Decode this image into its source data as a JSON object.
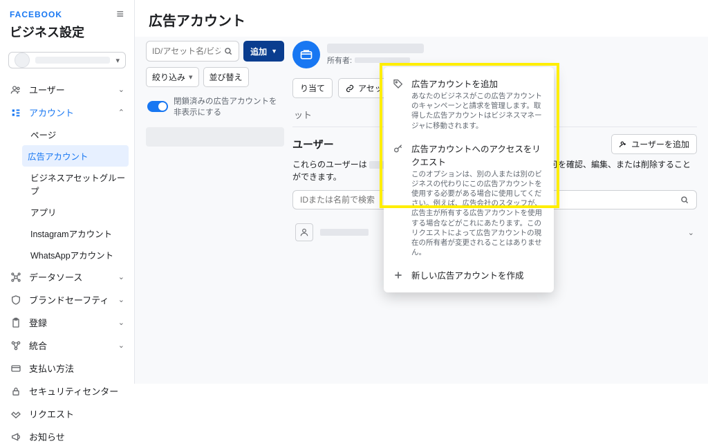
{
  "brand": "FACEBOOK",
  "sidebar_title": "ビジネス設定",
  "nav": {
    "users": "ユーザー",
    "accounts": "アカウント",
    "accounts_sub": {
      "page": "ページ",
      "ad_accounts": "広告アカウント",
      "asset_groups": "ビジネスアセットグループ",
      "apps": "アプリ",
      "instagram": "Instagramアカウント",
      "whatsapp": "WhatsAppアカウント"
    },
    "data_sources": "データソース",
    "brand_safety": "ブランドセーフティ",
    "registration": "登録",
    "integration": "統合",
    "payment": "支払い方法",
    "security": "セキュリティセンター",
    "requests": "リクエスト",
    "notices": "お知らせ"
  },
  "page_title": "広告アカウント",
  "list": {
    "search_placeholder": "ID/アセット名/ビジネス...",
    "add_button": "追加",
    "filter_button": "絞り込み",
    "sort_button": "並び替え",
    "toggle_label": "閉鎖済みの広告アカウントを非表示にする"
  },
  "popover": {
    "item1_title": "広告アカウントを追加",
    "item1_desc": "あなたのビジネスがこの広告アカウントのキャンペーンと請求を管理します。取得した広告アカウントはビジネスマネージャに移動されます。",
    "item2_title": "広告アカウントへのアクセスをリクエスト",
    "item2_desc": "このオプションは、別の人または別のビジネスの代わりにこの広告アカウントを使用する必要がある場合に使用してください。例えば、広告会社のスタッフが、広告主が所有する広告アカウントを使用する場合などがこれにあたります。このリクエストによって広告アカウントの現在の所有者が変更されることはありません。",
    "item3_title": "新しい広告アカウントを作成"
  },
  "detail": {
    "owner_label": "所有者:",
    "assign_button": "り当て",
    "add_asset_button": "アセットを追加",
    "tab1": "ット",
    "section_title": "ユーザー",
    "add_user_button": "ユーザーを追加",
    "desc_prefix": "これらのユーザーは",
    "desc_suffix": "にアクセスできます。アクセス許可を確認、編集、または削除することができます。",
    "user_search_placeholder": "IDまたは名前で検索"
  }
}
